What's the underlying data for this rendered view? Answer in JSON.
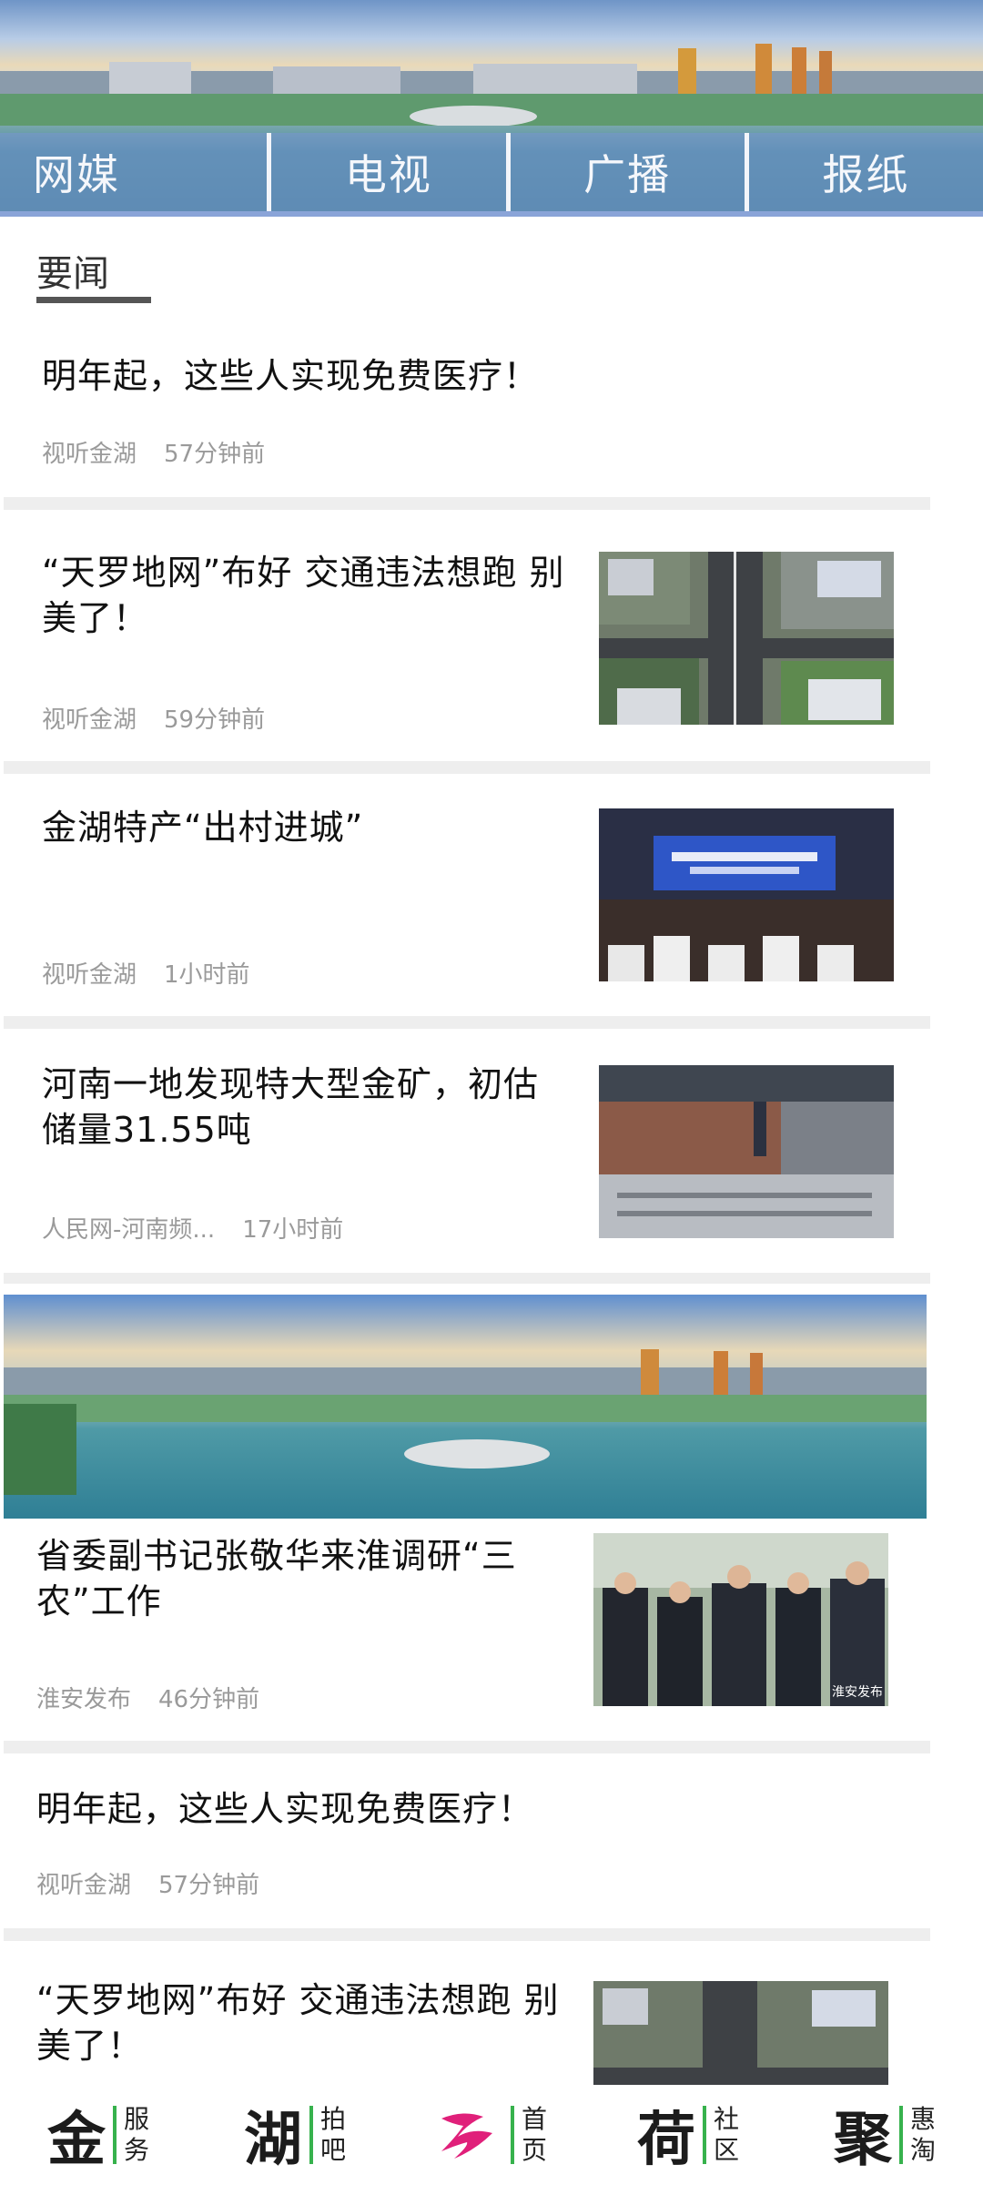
{
  "top_tabs": [
    "网媒",
    "电视",
    "广播",
    "报纸"
  ],
  "section_title": "要闻",
  "news": [
    {
      "title": "明年起，这些人实现免费医疗！",
      "source": "视听金湖",
      "time": "57分钟前"
    },
    {
      "title": "“天罗地网”布好 交通违法想跑 别美了！",
      "source": "视听金湖",
      "time": "59分钟前"
    },
    {
      "title": "金湖特产“出村进城”",
      "source": "视听金湖",
      "time": "1小时前"
    },
    {
      "title": "河南一地发现特大型金矿，初估储量31.55吨",
      "source": "人民网-河南频...",
      "time": "17小时前"
    },
    {
      "title": "省委副书记张敬华来淮调研“三农”工作",
      "source": "淮安发布",
      "time": "46分钟前"
    },
    {
      "title": "明年起，这些人实现免费医疗！",
      "source": "视听金湖",
      "time": "57分钟前"
    },
    {
      "title": "“天罗地网”布好 交通违法想跑 别美了！",
      "source": "",
      "time": ""
    }
  ],
  "thumb_caption": "淮安发布",
  "bottom_nav": [
    {
      "big": "金",
      "small": [
        "服",
        "务"
      ]
    },
    {
      "big": "湖",
      "small": [
        "拍",
        "吧"
      ]
    },
    {
      "big": "logo",
      "small": [
        "首",
        "页"
      ]
    },
    {
      "big": "荷",
      "small": [
        "社",
        "区"
      ]
    },
    {
      "big": "聚",
      "small": [
        "惠",
        "淘"
      ]
    }
  ],
  "colors": {
    "accent_green": "#37b24d",
    "logo_pink": "#e0207a",
    "tab_bg": "#7896d2"
  }
}
